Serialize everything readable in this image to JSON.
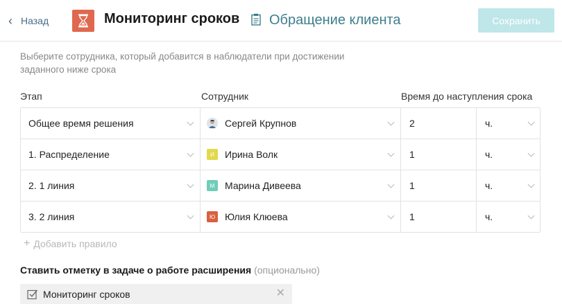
{
  "header": {
    "back_label": "Назад",
    "title": "Мониторинг сроков",
    "subtitle": "Обращение клиента",
    "save_label": "Сохранить",
    "logo_color": "#e0684f",
    "subtitle_color": "#3d7e8c",
    "save_bg": "#bfe6e9"
  },
  "description": "Выберите сотрудника, который добавится в наблюдатели при достижении заданного ниже срока",
  "columns": {
    "stage": "Этап",
    "user": "Сотрудник",
    "time": "Время до наступления срока"
  },
  "rows": [
    {
      "stage": "Общее время решения",
      "user": "Сергей Крупнов",
      "avatar": "",
      "avatar_color": "#dbe4ee",
      "time": "2",
      "unit": "ч."
    },
    {
      "stage": "1. Распределение",
      "user": "Ирина Волк",
      "avatar": "И",
      "avatar_color": "#e2d94b",
      "time": "1",
      "unit": "ч."
    },
    {
      "stage": "2. 1 линия",
      "user": "Марина Дивеева",
      "avatar": "М",
      "avatar_color": "#6fcdb8",
      "time": "1",
      "unit": "ч."
    },
    {
      "stage": "3. 2 линия",
      "user": "Юлия Клюева",
      "avatar": "Ю",
      "avatar_color": "#d9603f",
      "time": "1",
      "unit": "ч."
    }
  ],
  "add_rule_label": "Добавить правило",
  "mark": {
    "label": "Ставить отметку в задаче о работе расширения",
    "optional": "(опционально)",
    "tag": "Мониторинг сроков"
  },
  "icons": {
    "back": "chevron-left-icon",
    "logo": "hourglass-icon",
    "clipboard": "clipboard-icon",
    "add": "plus-icon",
    "check": "checkbox-icon",
    "remove": "close-icon"
  }
}
